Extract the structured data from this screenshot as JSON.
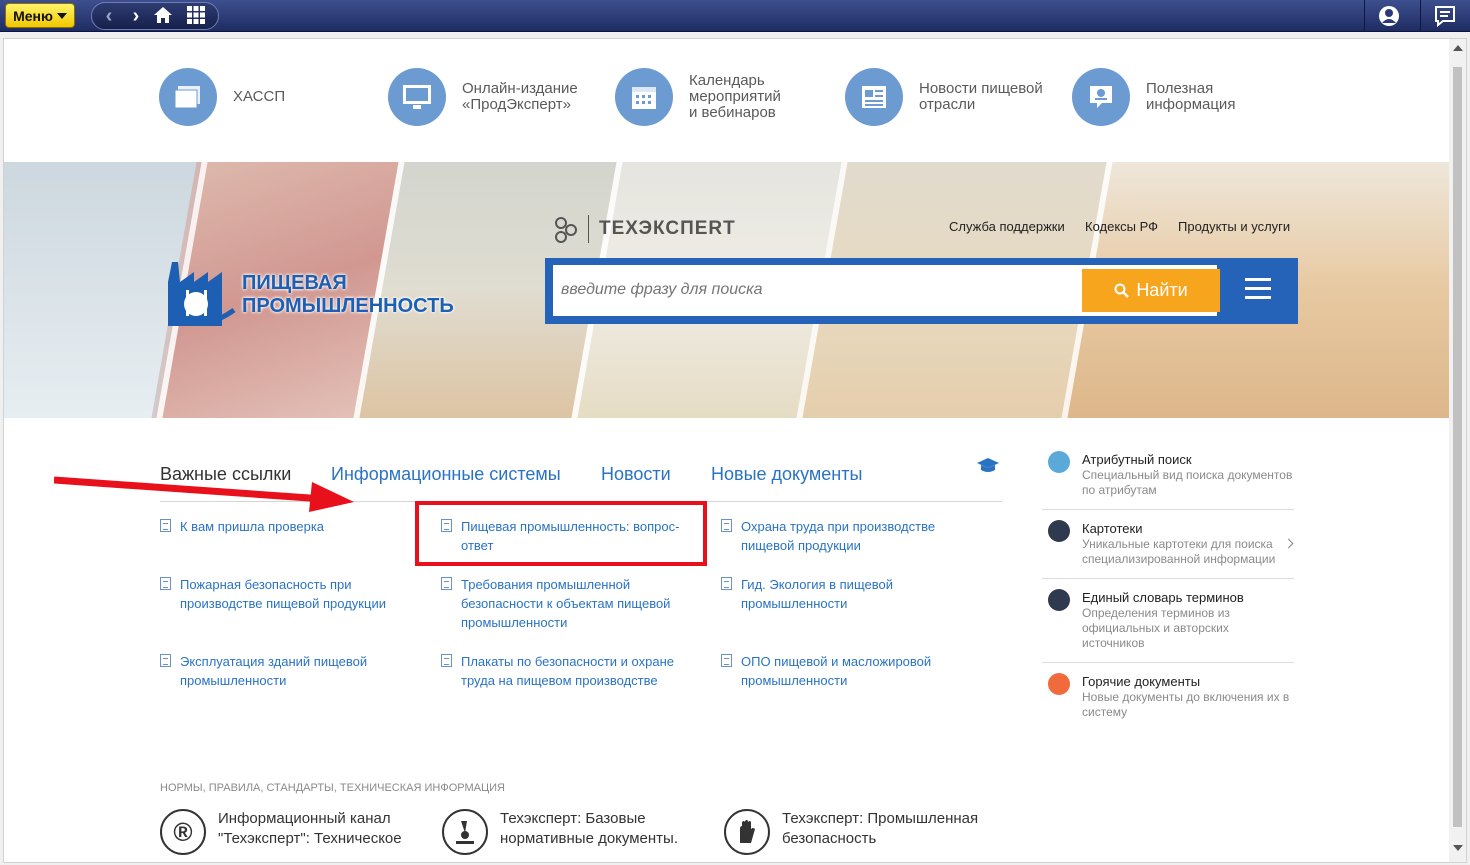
{
  "appbar": {
    "menu_label": "Меню"
  },
  "quick_links": [
    {
      "label": "ХАССП",
      "icon": "folders-icon"
    },
    {
      "label": "Онлайн-издание\n«ПродЭксперт»",
      "icon": "monitor-icon"
    },
    {
      "label": "Календарь\nмероприятий\nи вебинаров",
      "icon": "calendar-icon"
    },
    {
      "label": "Новости пищевой\nотрасли",
      "icon": "newspaper-icon"
    },
    {
      "label": "Полезная\nинформация",
      "icon": "info-board-icon"
    }
  ],
  "banner": {
    "logo_line1": "ПИЩЕВАЯ",
    "logo_line2": "ПРОМЫШЛЕННОСТЬ",
    "techexpert": "ТЕХЭКСПЕRТ",
    "top_links": [
      "Служба поддержки",
      "Кодексы РФ",
      "Продукты и услуги"
    ],
    "search_placeholder": "введите фразу для поиска",
    "search_button": "Найти"
  },
  "tabs": [
    "Важные ссылки",
    "Информационные системы",
    "Новости",
    "Новые документы"
  ],
  "links": [
    {
      "text": "К вам пришла проверка"
    },
    {
      "text": "Пищевая промышленность: вопрос-ответ"
    },
    {
      "text": "Охрана труда при производстве пищевой продукции"
    },
    {
      "text": "Пожарная безопасность при производстве пищевой продукции"
    },
    {
      "text": "Требования промышленной безопасности к объектам пищевой промышленности"
    },
    {
      "text": "Гид. Экология в пищевой промышленности"
    },
    {
      "text": "Эксплуатация зданий пищевой промышленности"
    },
    {
      "text": "Плакаты по безопасности и охране труда на пищевом производстве"
    },
    {
      "text": "ОПО пищевой и масложировой промышленности"
    }
  ],
  "side_items": [
    {
      "title": "Атрибутный поиск",
      "desc": "Специальный вид поиска документов по атрибутам",
      "color": "#5aa9d8"
    },
    {
      "title": "Картотеки",
      "desc": "Уникальные картотеки для поиска специализированной информации",
      "color": "#2f3a4f"
    },
    {
      "title": "Единый словарь терминов",
      "desc": "Определения терминов из официальных и авторских источников",
      "color": "#2f3a4f"
    },
    {
      "title": "Горячие документы",
      "desc": "Новые документы до включения их в систему",
      "color": "#f06a3c"
    }
  ],
  "norms": {
    "heading": "НОРМЫ, ПРАВИЛА, СТАНДАРТЫ, ТЕХНИЧЕСКАЯ ИНФОРМАЦИЯ",
    "items": [
      {
        "title": "Информационный канал \"Техэксперт\": Техническое",
        "icon": "registered-icon"
      },
      {
        "title": "Техэксперт: Базовые нормативные документы.",
        "icon": "microscope-icon"
      },
      {
        "title": "Техэксперт: Промышленная безопасность",
        "icon": "glove-icon"
      }
    ]
  }
}
